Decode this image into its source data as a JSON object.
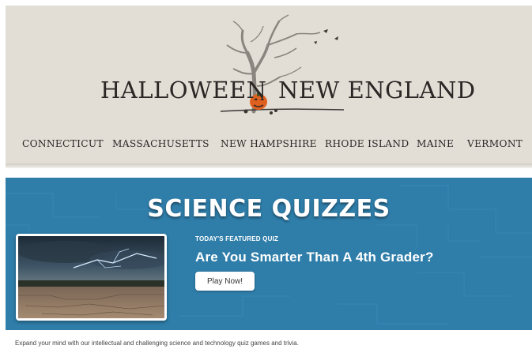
{
  "site": {
    "logo_left": "HALLOWEEN",
    "logo_right": "NEW ENGLAND"
  },
  "nav": {
    "items": [
      {
        "label": "CONNECTICUT"
      },
      {
        "label": "MASSACHUSETTS"
      },
      {
        "label": "NEW HAMPSHIRE"
      },
      {
        "label": "RHODE ISLAND"
      },
      {
        "label": "MAINE"
      },
      {
        "label": "VERMONT"
      }
    ]
  },
  "quiz": {
    "title": "SCIENCE QUIZZES",
    "featured_label": "TODAY'S FEATURED QUIZ",
    "featured_title": "Are You Smarter Than A 4th Grader?",
    "play_button": "Play Now!",
    "description": "Expand your mind with our intellectual and challenging science and technology quiz games and trivia."
  },
  "colors": {
    "header_bg": "#e2ded6",
    "quiz_bg": "#2f7eaa",
    "pumpkin": "#e0611f",
    "text_dark": "#2b2725"
  },
  "icons": {
    "logo": "bare-tree-pumpkin-icon",
    "thumbnail": "lightning-storm-image"
  }
}
